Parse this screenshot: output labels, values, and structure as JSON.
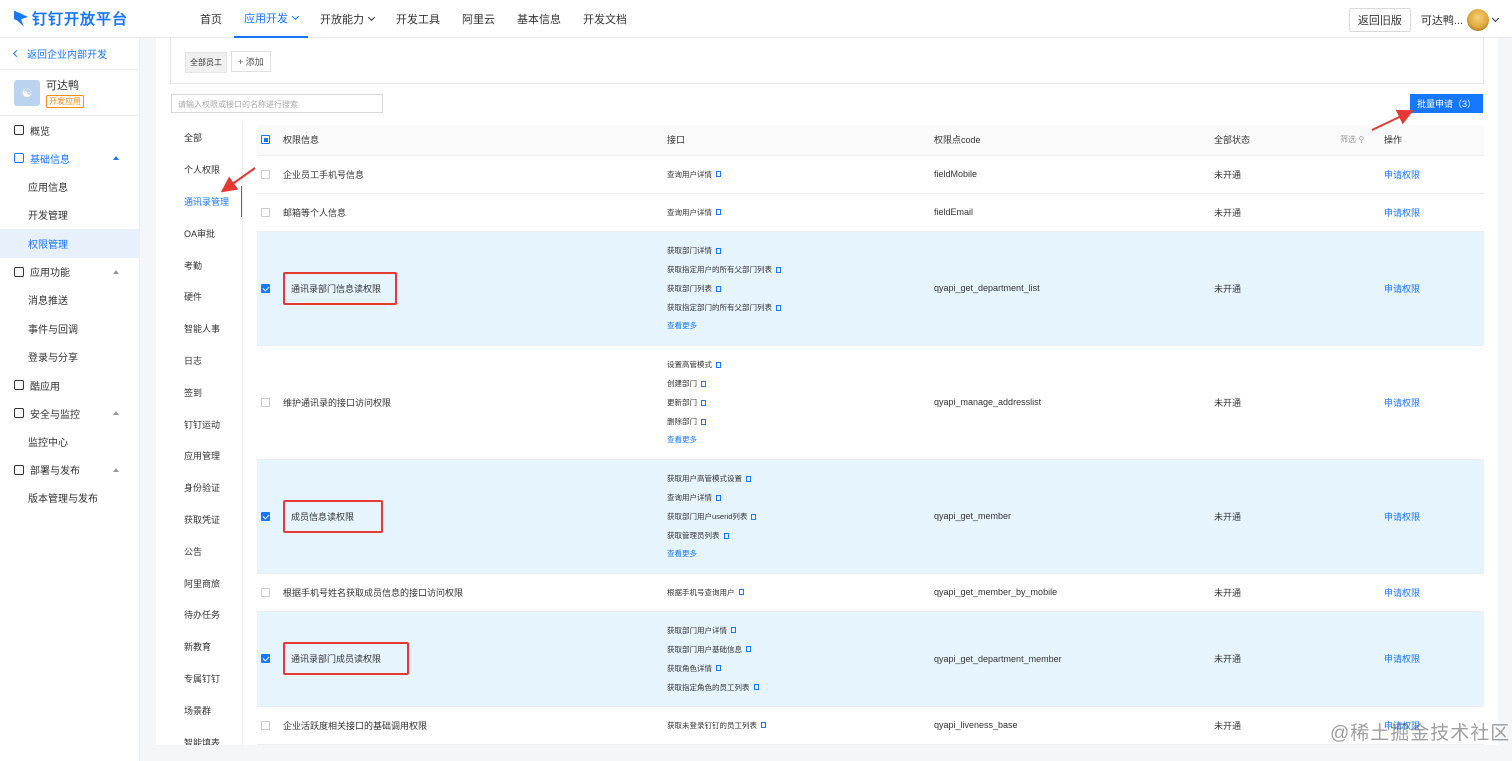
{
  "brand": {
    "name": "钉钉开放平台",
    "color": "#1677ff"
  },
  "topnav": {
    "items": [
      {
        "label": "首页",
        "active": false,
        "dropdown": false
      },
      {
        "label": "应用开发",
        "active": true,
        "dropdown": true
      },
      {
        "label": "开放能力",
        "active": false,
        "dropdown": true
      },
      {
        "label": "开发工具",
        "active": false,
        "dropdown": false
      },
      {
        "label": "阿里云",
        "active": false,
        "dropdown": false
      },
      {
        "label": "基本信息",
        "active": false,
        "dropdown": false
      },
      {
        "label": "开发文档",
        "active": false,
        "dropdown": false
      }
    ],
    "old_version_label": "返回旧版",
    "user_label": "可达鸭..."
  },
  "sidebar": {
    "back_label": "返回企业内部开发",
    "app_name": "可达鸭",
    "app_badge": "开发应用",
    "menu": [
      {
        "label": "概览",
        "type": "group",
        "open": false
      },
      {
        "label": "基础信息",
        "type": "group",
        "open": true
      },
      {
        "label": "应用信息",
        "type": "sub",
        "active": false
      },
      {
        "label": "开发管理",
        "type": "sub",
        "active": false
      },
      {
        "label": "权限管理",
        "type": "sub",
        "active": true
      },
      {
        "label": "应用功能",
        "type": "group",
        "open": false
      },
      {
        "label": "消息推送",
        "type": "sub",
        "active": false
      },
      {
        "label": "事件与回调",
        "type": "sub",
        "active": false
      },
      {
        "label": "登录与分享",
        "type": "sub",
        "active": false
      },
      {
        "label": "酷应用",
        "type": "group",
        "open": false
      },
      {
        "label": "安全与监控",
        "type": "group",
        "open": false
      },
      {
        "label": "监控中心",
        "type": "sub",
        "active": false
      },
      {
        "label": "部署与发布",
        "type": "group",
        "open": false
      },
      {
        "label": "版本管理与发布",
        "type": "sub",
        "active": false
      }
    ]
  },
  "scope": {
    "tag": "全部员工",
    "add_label": "+ 添加"
  },
  "search": {
    "placeholder": "请输入权限或接口的名称进行搜索"
  },
  "batch_button": "批量申请（3）",
  "categories": [
    {
      "label": "全部",
      "active": false
    },
    {
      "label": "个人权限",
      "active": false
    },
    {
      "label": "通讯录管理",
      "active": true
    },
    {
      "label": "OA审批",
      "active": false
    },
    {
      "label": "考勤",
      "active": false
    },
    {
      "label": "硬件",
      "active": false
    },
    {
      "label": "智能人事",
      "active": false
    },
    {
      "label": "日志",
      "active": false
    },
    {
      "label": "签到",
      "active": false
    },
    {
      "label": "钉钉运动",
      "active": false
    },
    {
      "label": "应用管理",
      "active": false
    },
    {
      "label": "身份验证",
      "active": false
    },
    {
      "label": "获取凭证",
      "active": false
    },
    {
      "label": "公告",
      "active": false
    },
    {
      "label": "阿里商旅",
      "active": false
    },
    {
      "label": "待办任务",
      "active": false
    },
    {
      "label": "新教育",
      "active": false
    },
    {
      "label": "专属钉钉",
      "active": false
    },
    {
      "label": "场景群",
      "active": false
    },
    {
      "label": "智能填表",
      "active": false
    }
  ],
  "table": {
    "headers": {
      "info": "权限信息",
      "api": "接口",
      "code": "权限点code",
      "status": "全部状态",
      "filter": "筛选",
      "action": "操作"
    },
    "rows": [
      {
        "name": "企业员工手机号信息",
        "apis": [
          "查询用户详情"
        ],
        "more": "",
        "code": "fieldMobile",
        "status": "未开通",
        "action": "申请权限",
        "checked": false,
        "highlight": false
      },
      {
        "name": "邮箱等个人信息",
        "apis": [
          "查询用户详情"
        ],
        "more": "",
        "code": "fieldEmail",
        "status": "未开通",
        "action": "申请权限",
        "checked": false,
        "highlight": false
      },
      {
        "name": "通讯录部门信息读权限",
        "apis": [
          "获取部门详情",
          "获取指定用户的所有父部门列表",
          "获取部门列表",
          "获取指定部门的所有父部门列表"
        ],
        "more": "查看更多",
        "code": "qyapi_get_department_list",
        "status": "未开通",
        "action": "申请权限",
        "checked": true,
        "highlight": true
      },
      {
        "name": "维护通讯录的接口访问权限",
        "apis": [
          "设置高管模式",
          "创建部门",
          "更新部门",
          "删除部门"
        ],
        "more": "查看更多",
        "code": "qyapi_manage_addresslist",
        "status": "未开通",
        "action": "申请权限",
        "checked": false,
        "highlight": false
      },
      {
        "name": "成员信息读权限",
        "apis": [
          "获取用户高管模式设置",
          "查询用户详情",
          "获取部门用户userid列表",
          "获取管理员列表"
        ],
        "more": "查看更多",
        "code": "qyapi_get_member",
        "status": "未开通",
        "action": "申请权限",
        "checked": true,
        "highlight": true
      },
      {
        "name": "根据手机号姓名获取成员信息的接口访问权限",
        "apis": [
          "根据手机号查询用户"
        ],
        "more": "",
        "code": "qyapi_get_member_by_mobile",
        "status": "未开通",
        "action": "申请权限",
        "checked": false,
        "highlight": false
      },
      {
        "name": "通讯录部门成员读权限",
        "apis": [
          "获取部门用户详情",
          "获取部门用户基础信息",
          "获取角色详情",
          "获取指定角色的员工列表"
        ],
        "more": "",
        "code": "qyapi_get_department_member",
        "status": "未开通",
        "action": "申请权限",
        "checked": true,
        "highlight": true
      },
      {
        "name": "企业活跃度相关接口的基础调用权限",
        "apis": [
          "获取未登录钉钉的员工列表"
        ],
        "more": "",
        "code": "qyapi_liveness_base",
        "status": "未开通",
        "action": "申请权限",
        "checked": false,
        "highlight": false
      }
    ]
  },
  "watermark": "@稀土掘金技术社区",
  "annotation_color": "#e53935"
}
